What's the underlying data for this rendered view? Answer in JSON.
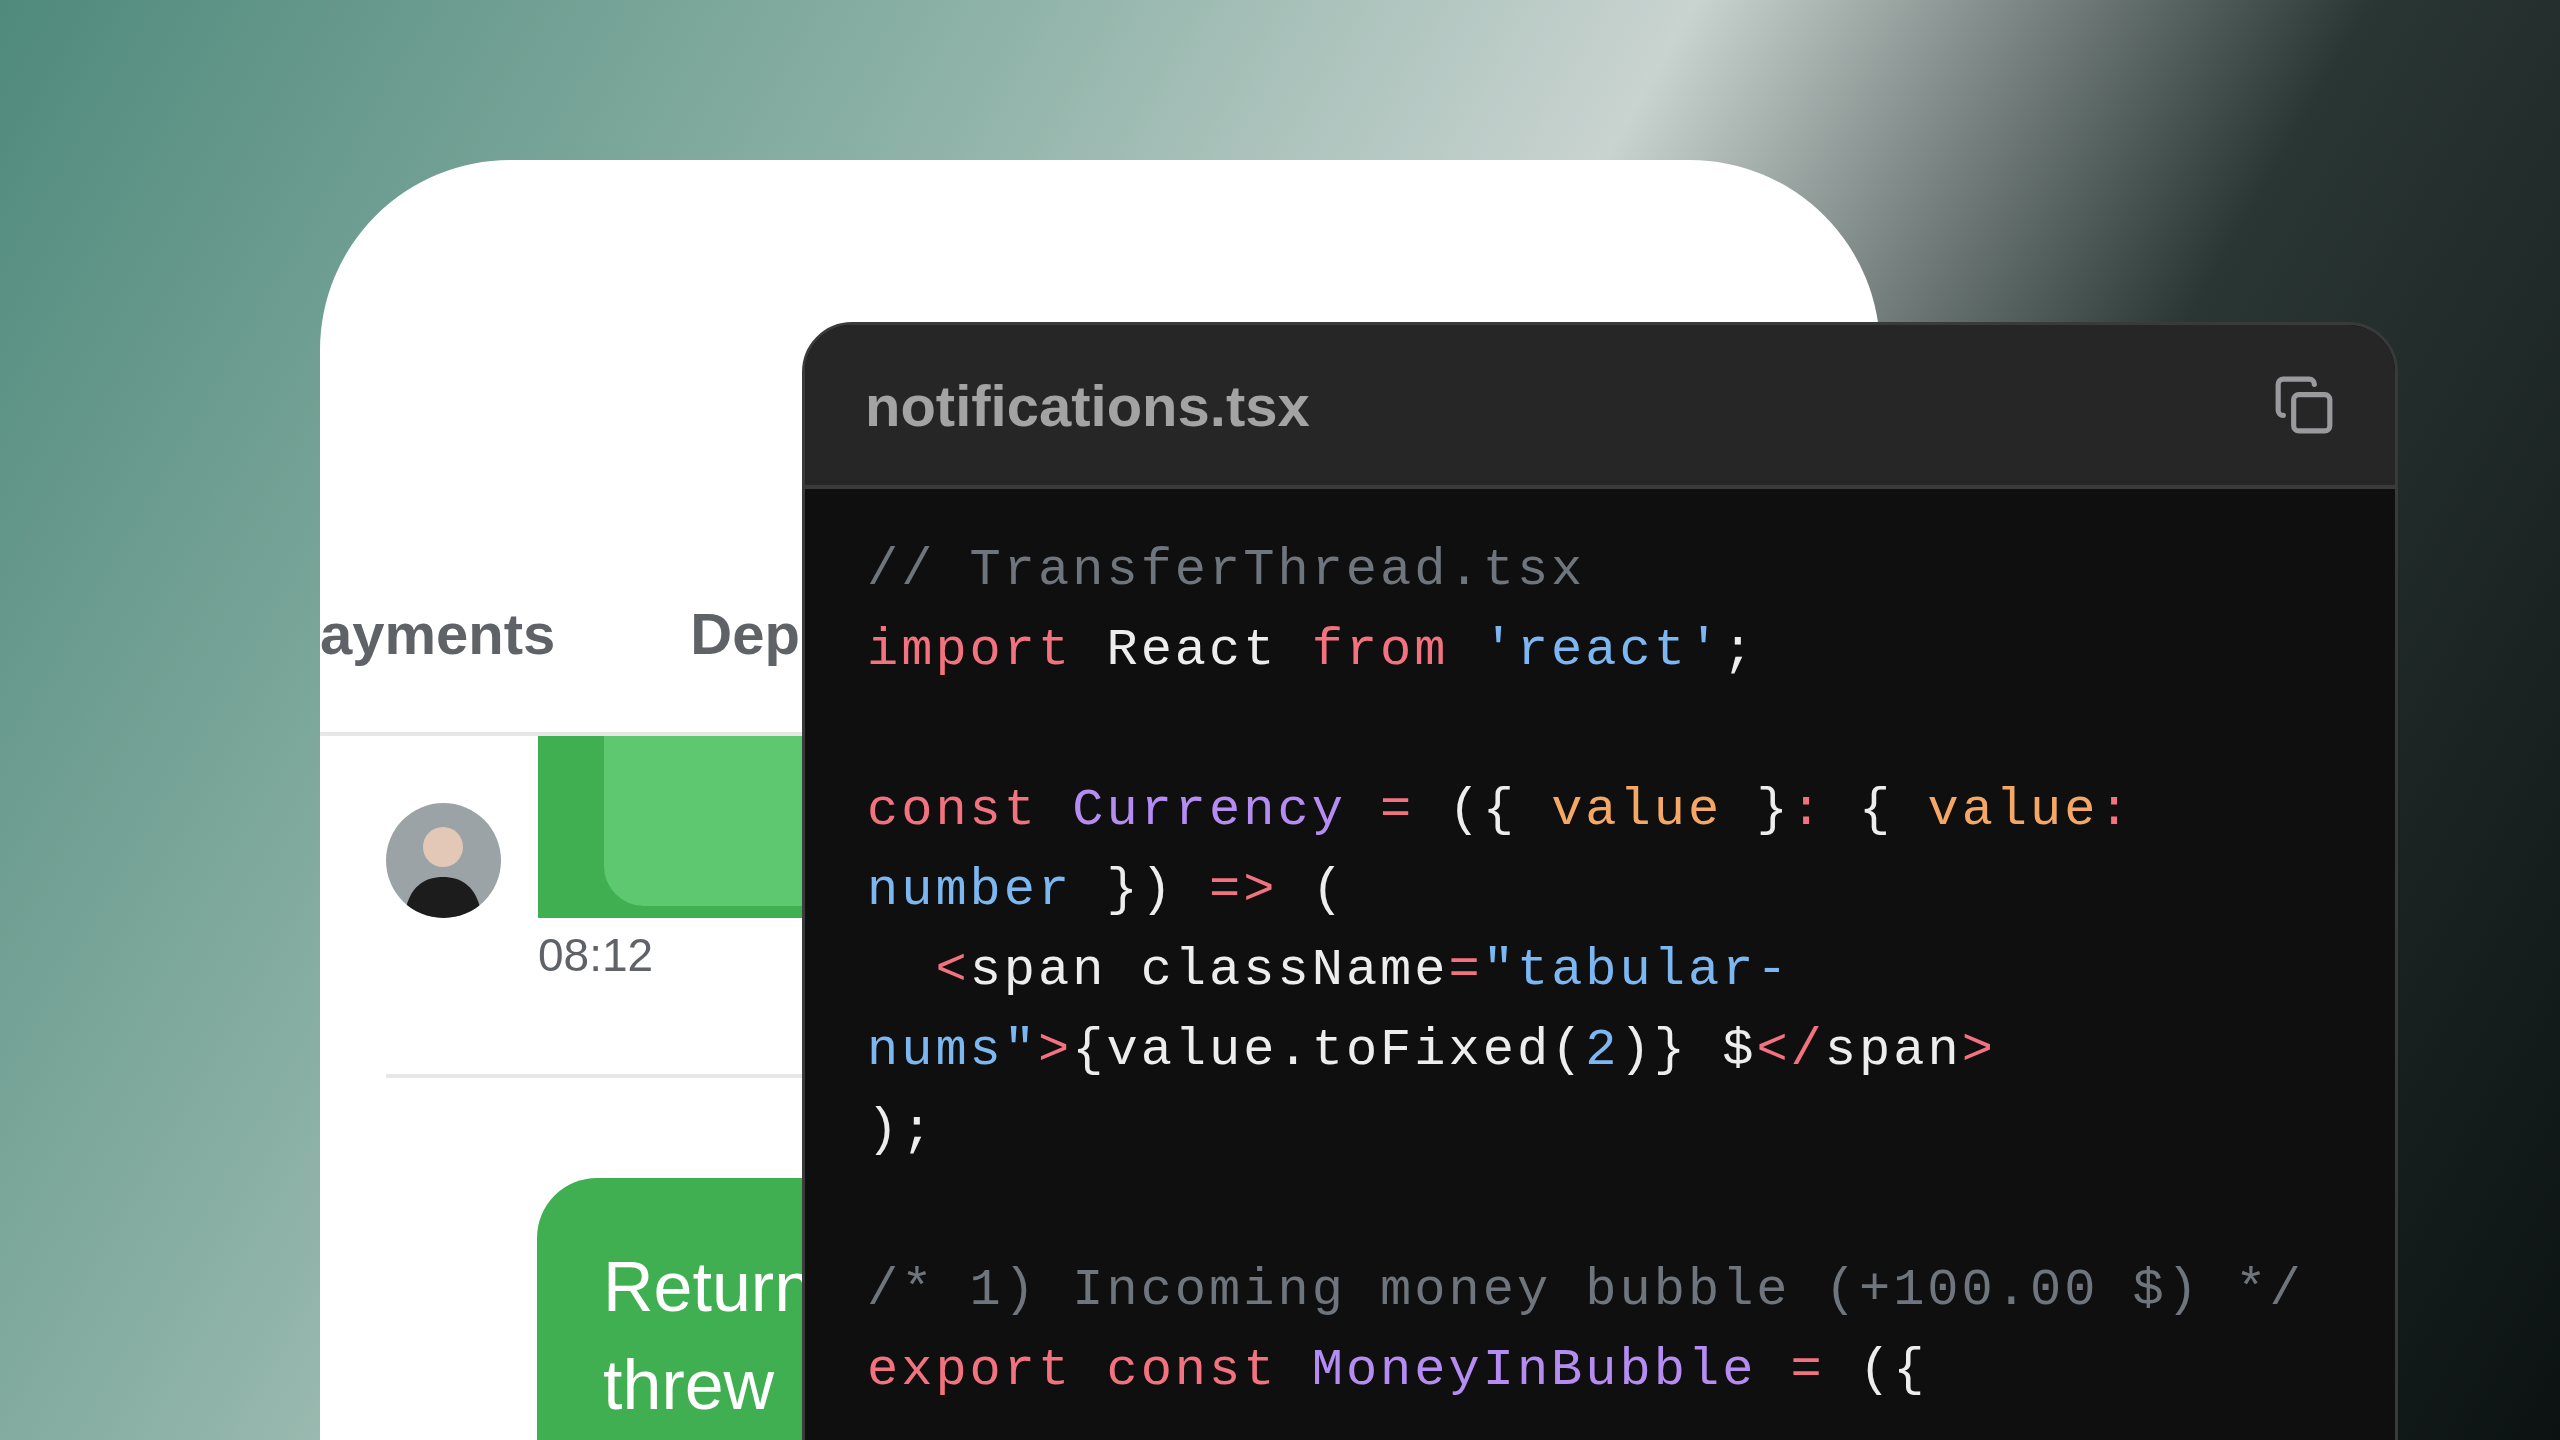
{
  "phone": {
    "tabs": [
      {
        "label": "ayments"
      },
      {
        "label": "Dep"
      }
    ],
    "messages": [
      {
        "kind": "incoming",
        "time": "08:12"
      },
      {
        "kind": "outgoing",
        "lines": [
          "Return",
          "threw"
        ]
      }
    ]
  },
  "code_window": {
    "title": "notifications.tsx",
    "lines": [
      {
        "kind": "code",
        "tokens": [
          {
            "t": "// TransferThread.tsx",
            "kind": "comment"
          }
        ]
      },
      {
        "kind": "code",
        "tokens": [
          {
            "t": "import ",
            "kind": "keyword"
          },
          {
            "t": "React ",
            "kind": "plain"
          },
          {
            "t": "from ",
            "kind": "keyword"
          },
          {
            "t": "'react'",
            "kind": "string"
          },
          {
            "t": ";",
            "kind": "plain"
          }
        ]
      },
      {
        "kind": "blank"
      },
      {
        "kind": "code",
        "tokens": [
          {
            "t": "const ",
            "kind": "keyword"
          },
          {
            "t": "Currency ",
            "kind": "name"
          },
          {
            "t": "= ",
            "kind": "operator"
          },
          {
            "t": "({ ",
            "kind": "plain"
          },
          {
            "t": "value ",
            "kind": "param"
          },
          {
            "t": "}",
            "kind": "plain"
          },
          {
            "t": ": ",
            "kind": "operator"
          },
          {
            "t": "{ ",
            "kind": "plain"
          },
          {
            "t": "value",
            "kind": "param"
          },
          {
            "t": ":",
            "kind": "operator"
          }
        ]
      },
      {
        "kind": "code",
        "tokens": [
          {
            "t": "number ",
            "kind": "string"
          },
          {
            "t": "}) ",
            "kind": "plain"
          },
          {
            "t": "=> ",
            "kind": "operator"
          },
          {
            "t": "(",
            "kind": "plain"
          }
        ]
      },
      {
        "kind": "code",
        "tokens": [
          {
            "t": "  <",
            "kind": "operator"
          },
          {
            "t": "span className",
            "kind": "plain"
          },
          {
            "t": "=",
            "kind": "operator"
          },
          {
            "t": "\"tabular-",
            "kind": "string"
          }
        ]
      },
      {
        "kind": "code",
        "tokens": [
          {
            "t": "nums\"",
            "kind": "string"
          },
          {
            "t": ">",
            "kind": "operator"
          },
          {
            "t": "{value.toFixed(",
            "kind": "plain"
          },
          {
            "t": "2",
            "kind": "string"
          },
          {
            "t": ")} $",
            "kind": "plain"
          },
          {
            "t": "</",
            "kind": "operator"
          },
          {
            "t": "span",
            "kind": "plain"
          },
          {
            "t": ">",
            "kind": "operator"
          }
        ]
      },
      {
        "kind": "code",
        "tokens": [
          {
            "t": ");",
            "kind": "plain"
          }
        ]
      },
      {
        "kind": "blank"
      },
      {
        "kind": "code",
        "tokens": [
          {
            "t": "/* 1) Incoming money bubble (+100.00 $) */",
            "kind": "comment"
          }
        ]
      },
      {
        "kind": "code",
        "tokens": [
          {
            "t": "export ",
            "kind": "keyword"
          },
          {
            "t": "const ",
            "kind": "keyword"
          },
          {
            "t": "MoneyInBubble ",
            "kind": "name"
          },
          {
            "t": "= ",
            "kind": "operator"
          },
          {
            "t": "({",
            "kind": "plain"
          }
        ]
      }
    ]
  }
}
